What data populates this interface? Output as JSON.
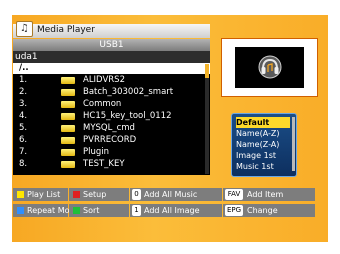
{
  "window": {
    "title": "Media Player",
    "device": "USB1",
    "path": "uda1"
  },
  "file_list": {
    "up_entry": "/..",
    "items": [
      {
        "index": "1.",
        "name": "ALIDVRS2"
      },
      {
        "index": "2.",
        "name": "Batch_303002_smart"
      },
      {
        "index": "3.",
        "name": "Common"
      },
      {
        "index": "4.",
        "name": "HC15_key_tool_0112"
      },
      {
        "index": "5.",
        "name": "MYSQL_cmd"
      },
      {
        "index": "6.",
        "name": "PVRRECORD"
      },
      {
        "index": "7.",
        "name": "Plugin"
      },
      {
        "index": "8.",
        "name": "TEST_KEY"
      }
    ]
  },
  "sort_menu": {
    "options": [
      "Default",
      "Name(A-Z)",
      "Name(Z-A)",
      "Image 1st",
      "Music 1st"
    ],
    "selected": "Default"
  },
  "hints": {
    "play_list": "Play List",
    "setup": "Setup",
    "add_all_music_key": "0",
    "add_all_music": "Add All Music",
    "fav_key": "FAV",
    "add_item": "Add Item",
    "repeat_mode": "Repeat Mode",
    "sort": "Sort",
    "add_all_image_key": "1",
    "add_all_image": "Add All Image",
    "epg_key": "EPG",
    "change": "Change"
  },
  "colors": {
    "yellow_key": "#ffe600",
    "red_key": "#e02020",
    "blue_key": "#2f8fff",
    "green_key": "#1fbf3a",
    "panel_orange": "#f9ad28",
    "highlight": "#fdd92a"
  }
}
